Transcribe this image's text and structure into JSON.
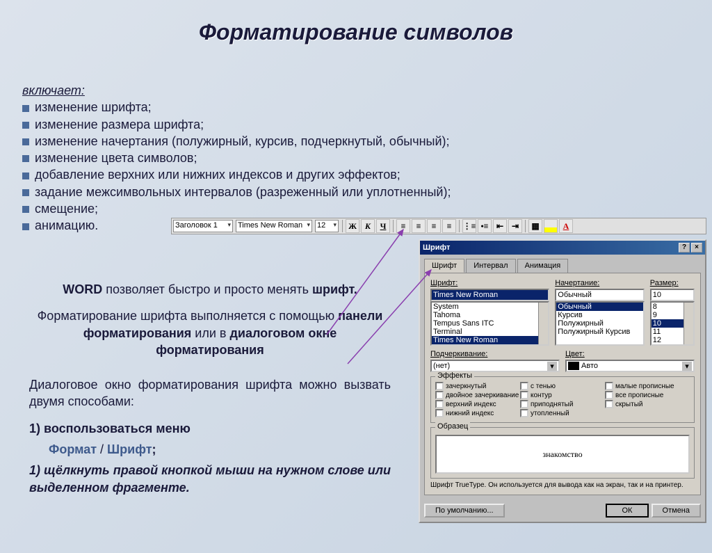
{
  "title": "Форматирование символов",
  "intro": "включает:",
  "bullets": [
    "изменение шрифта;",
    "изменение размера шрифта;",
    "изменение начертания (полужирный, курсив, подчеркнутый, обычный);",
    "изменение цвета символов;",
    "добавление верхних или нижних индексов и других эффектов;",
    "задание межсимвольных интервалов (разреженный или уплотненный);",
    "смещение;",
    "анимацию."
  ],
  "body": {
    "p1a": "WORD",
    "p1b": " позволяет быстро и просто менять ",
    "p1c": "шрифт.",
    "p2a": "Форматирование шрифта выполняется с помощью ",
    "p2b": "панели форматирования",
    "p2c": "     или в ",
    "p2d": "диалоговом окне форматирования",
    "p3": "Диалоговое окно форматирования шрифта можно вызвать двумя способами:",
    "ol1a": "1)  воспользоваться меню",
    "ol1b": "Формат",
    "ol1c": " / ",
    "ol1d": "Шрифт",
    "ol1e": ";",
    "ol2": "1)  щёлкнуть правой кнопкой мыши на нужном слове или выделенном фрагменте."
  },
  "toolbar": {
    "style": "Заголовок 1",
    "font": "Times New Roman",
    "size": "12",
    "bold": "Ж",
    "italic": "К",
    "underline": "Ч"
  },
  "dialog": {
    "title": "Шрифт",
    "tabs": [
      "Шрифт",
      "Интервал",
      "Анимация"
    ],
    "labels": {
      "font": "Шрифт:",
      "style": "Начертание:",
      "size": "Размер:",
      "underline": "Подчеркивание:",
      "color": "Цвет:"
    },
    "font_value": "Times New Roman",
    "font_list": [
      "System",
      "Tahoma",
      "Tempus Sans ITC",
      "Terminal",
      "Times New Roman"
    ],
    "style_value": "Обычный",
    "style_list": [
      "Обычный",
      "Курсив",
      "Полужирный",
      "Полужирный Курсив"
    ],
    "size_value": "10",
    "size_list": [
      "8",
      "9",
      "10",
      "11",
      "12"
    ],
    "underline_value": "(нет)",
    "color_value": "Авто",
    "effects_legend": "Эффекты",
    "effects": {
      "col1": [
        "зачеркнутый",
        "двойное зачеркивание",
        "верхний индекс",
        "нижний индекс"
      ],
      "col2": [
        "с тенью",
        "контур",
        "приподнятый",
        "утопленный"
      ],
      "col3": [
        "малые прописные",
        "все прописные",
        "скрытый"
      ]
    },
    "sample_legend": "Образец",
    "sample_text": "знакомство",
    "hint": "Шрифт TrueType. Он используется для вывода как на экран, так и на принтер.",
    "buttons": {
      "default": "По умолчанию...",
      "ok": "ОК",
      "cancel": "Отмена"
    }
  }
}
